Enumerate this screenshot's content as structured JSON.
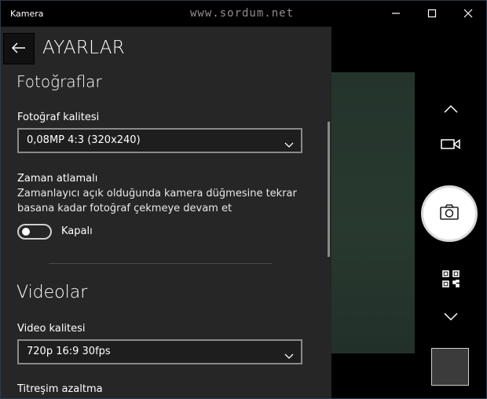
{
  "window": {
    "title": "Kamera",
    "watermark": "www.sordum.net"
  },
  "settings": {
    "title": "AYARLAR",
    "photos": {
      "heading": "Fotoğraflar",
      "quality_label": "Fotoğraf kalitesi",
      "quality_value": "0,08MP 4:3 (320x240)",
      "timelapse_label": "Zaman atlamalı",
      "timelapse_desc_line1": "Zamanlayıcı açık olduğunda kamera düğmesine tekrar",
      "timelapse_desc_line2": "basana kadar fotoğraf çekmeye devam et",
      "timelapse_toggle_state": "Kapalı"
    },
    "videos": {
      "heading": "Videolar",
      "quality_label": "Video kalitesi",
      "quality_value": "720p 16:9 30fps",
      "stabilization_label": "Titreşim azaltma"
    }
  },
  "icons": {
    "back": "arrow-left-icon",
    "minimize": "minimize-icon",
    "maximize": "maximize-icon",
    "close": "close-icon",
    "up": "chevron-up-icon",
    "video": "video-camera-icon",
    "photo": "camera-icon",
    "qr": "qr-code-icon",
    "down": "chevron-down-icon"
  },
  "colors": {
    "panel": "#262626",
    "background": "#000000",
    "preview": "#26362d"
  }
}
